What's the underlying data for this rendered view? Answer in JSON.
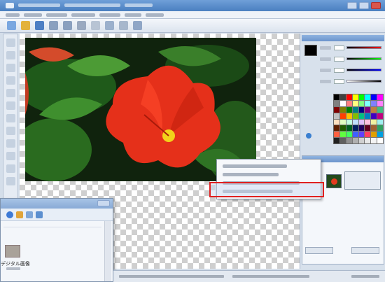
{
  "window": {
    "title": ""
  },
  "menubar": {
    "items": [
      "",
      "",
      "",
      "",
      "",
      "",
      ""
    ]
  },
  "toolbar": {
    "buttons": [
      "new-icon",
      "open-icon",
      "save-icon",
      "undo-icon",
      "redo-icon",
      "zoom-icon",
      "select-icon",
      "crop-icon",
      "grid-icon",
      "layer-icon"
    ]
  },
  "tools": [
    "move-tool-icon",
    "select-tool-icon",
    "lasso-tool-icon",
    "magic-wand-icon",
    "brush-tool-icon",
    "eraser-tool-icon",
    "fill-tool-icon",
    "text-tool-icon",
    "eyedropper-icon",
    "shape-tool-icon",
    "hand-tool-icon",
    "zoom-tool-icon"
  ],
  "color_panel": {
    "title": "",
    "current_color": "#000000"
  },
  "palette_colors": [
    "#000000",
    "#404040",
    "#ff0000",
    "#ffff00",
    "#00ff00",
    "#00ffff",
    "#0000ff",
    "#ff00ff",
    "#808080",
    "#ffffff",
    "#ff8080",
    "#ffff80",
    "#80ff80",
    "#80ffff",
    "#8080ff",
    "#ff80ff",
    "#800000",
    "#808000",
    "#008000",
    "#008080",
    "#000080",
    "#800080",
    "#c08040",
    "#40c080",
    "#c0c0c0",
    "#ff4000",
    "#ffc000",
    "#80c000",
    "#00c080",
    "#0080c0",
    "#4000c0",
    "#c00080",
    "#ffe0c0",
    "#e0ffc0",
    "#c0ffe0",
    "#c0e0ff",
    "#e0c0ff",
    "#ffc0e0",
    "#f0f0a0",
    "#a0f0f0",
    "#602000",
    "#206000",
    "#006020",
    "#002060",
    "#200060",
    "#600020",
    "#a06030",
    "#30a060",
    "#ff6040",
    "#60ff40",
    "#40ff60",
    "#4060ff",
    "#6040ff",
    "#ff4060",
    "#e0a000",
    "#00a0e0",
    "#202020",
    "#606060",
    "#909090",
    "#b0b0b0",
    "#d0d0d0",
    "#e8e8e8",
    "#f4f4f4",
    "#ffffff"
  ],
  "layers_panel": {
    "title": ""
  },
  "context_menu": {
    "items": [
      "",
      "",
      "",
      ""
    ],
    "highlighted_index": 3
  },
  "explorer": {
    "title": "",
    "file_label": "デジタル画像"
  },
  "statusbar": {
    "text": ""
  },
  "accent_colors": {
    "highlight_border": "#e02020",
    "flower": "#e23b1e",
    "title_bar": "#4a7fc0"
  }
}
